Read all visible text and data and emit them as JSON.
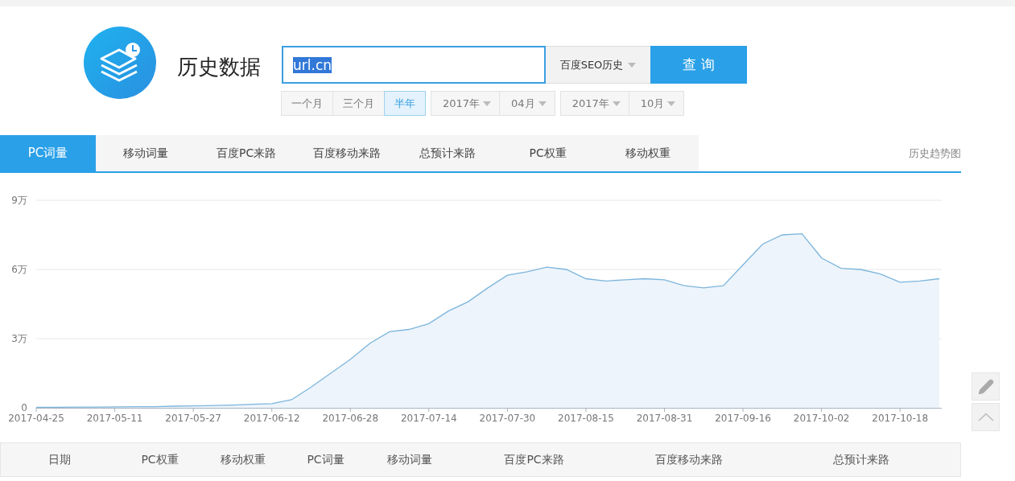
{
  "header": {
    "title": "历史数据"
  },
  "search": {
    "value": "url.cn",
    "highlighted": true,
    "source": "百度SEO历史",
    "button": "查 询"
  },
  "periods": [
    {
      "label": "一个月",
      "selected": false
    },
    {
      "label": "三个月",
      "selected": false
    },
    {
      "label": "半年",
      "selected": true
    }
  ],
  "date_range": [
    {
      "label": "2017年"
    },
    {
      "label": "04月"
    },
    {
      "label": "2017年"
    },
    {
      "label": "10月"
    }
  ],
  "tabs": [
    {
      "label": "PC词量",
      "selected": true
    },
    {
      "label": "移动词量",
      "selected": false
    },
    {
      "label": "百度PC来路",
      "selected": false
    },
    {
      "label": "百度移动来路",
      "selected": false
    },
    {
      "label": "总预计来路",
      "selected": false
    },
    {
      "label": "PC权重",
      "selected": false
    },
    {
      "label": "移动权重",
      "selected": false
    }
  ],
  "trend_link": "历史趋势图",
  "chart_data": {
    "type": "area",
    "categories": [
      "2017-04-25",
      null,
      null,
      null,
      "2017-05-11",
      null,
      null,
      null,
      "2017-05-27",
      null,
      null,
      null,
      "2017-06-12",
      null,
      null,
      null,
      "2017-06-28",
      null,
      null,
      null,
      "2017-07-14",
      null,
      null,
      null,
      "2017-07-30",
      null,
      null,
      null,
      "2017-08-15",
      null,
      null,
      null,
      "2017-08-31",
      null,
      null,
      null,
      "2017-09-16",
      null,
      null,
      null,
      "2017-10-02",
      null,
      null,
      null,
      "2017-10-18",
      null,
      null
    ],
    "series": [
      {
        "color": "#7cb5dc",
        "values": [
          0.02,
          0.02,
          0.03,
          0.03,
          0.04,
          0.05,
          0.05,
          0.07,
          0.08,
          0.1,
          0.12,
          0.15,
          0.18,
          0.35,
          0.9,
          1.5,
          2.1,
          2.8,
          3.3,
          3.4,
          3.65,
          4.2,
          4.6,
          5.2,
          5.75,
          5.9,
          6.1,
          6.0,
          5.6,
          5.5,
          5.55,
          5.6,
          5.55,
          5.3,
          5.2,
          5.3,
          6.2,
          7.1,
          7.5,
          7.55,
          6.5,
          6.05,
          6.0,
          5.8,
          5.45,
          5.5,
          5.6
        ]
      }
    ],
    "ylim": [
      0,
      9
    ],
    "yticks": [
      {
        "value": 0,
        "label": "0"
      },
      {
        "value": 3,
        "label": "3万"
      },
      {
        "value": 6,
        "label": "6万"
      },
      {
        "value": 9,
        "label": "9万"
      }
    ]
  },
  "table": {
    "columns": [
      "日期",
      "PC权重",
      "移动权重",
      "PC词量",
      "移动词量",
      "百度PC来路",
      "百度移动来路",
      "总预计来路"
    ]
  }
}
